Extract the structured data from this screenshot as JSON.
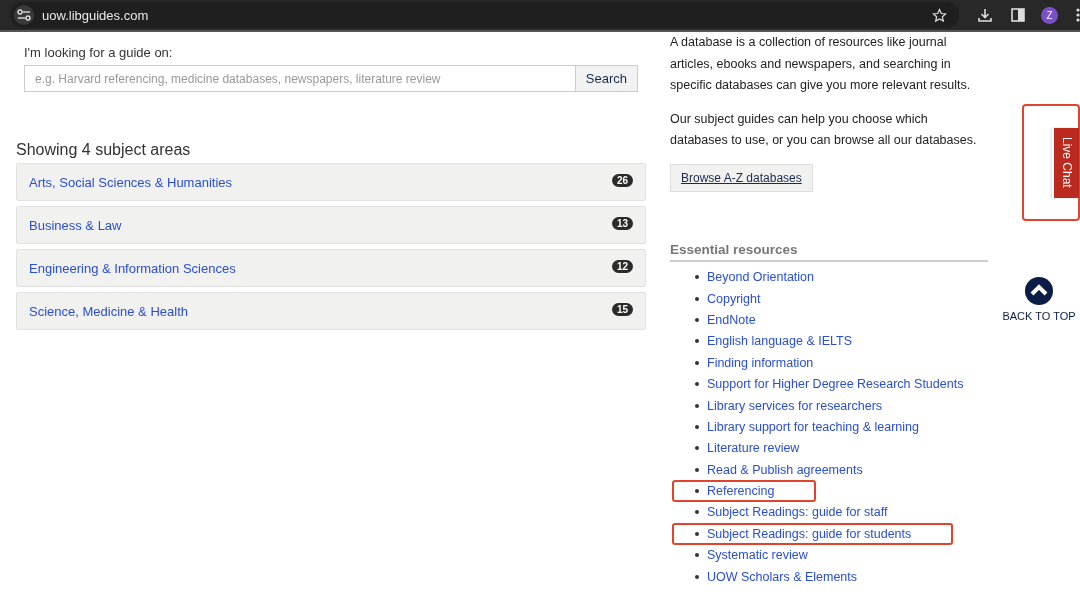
{
  "browser": {
    "url": "uow.libguides.com",
    "avatar": "Z"
  },
  "search": {
    "label": "I'm looking for a guide on:",
    "placeholder": "e.g. Harvard referencing, medicine databases, newspapers, literature review",
    "button": "Search"
  },
  "subjects": {
    "heading": "Showing 4 subject areas",
    "items": [
      {
        "name": "Arts, Social Sciences & Humanities",
        "count": "26"
      },
      {
        "name": "Business & Law",
        "count": "13"
      },
      {
        "name": "Engineering & Information Sciences",
        "count": "12"
      },
      {
        "name": "Science, Medicine & Health",
        "count": "15"
      }
    ]
  },
  "databases": {
    "paragraphs": [
      "A database is a collection of resources like journal articles, ebooks and newspapers, and searching in specific databases can give you more relevant results.",
      "Our subject guides can help you choose which databases to use, or you can browse all our databases."
    ],
    "button": "Browse A-Z databases"
  },
  "essential_resources": {
    "heading": "Essential resources",
    "items": [
      {
        "label": "Beyond Orientation",
        "highlighted": false
      },
      {
        "label": "Copyright",
        "highlighted": false
      },
      {
        "label": "EndNote",
        "highlighted": false
      },
      {
        "label": "English language & IELTS",
        "highlighted": false
      },
      {
        "label": "Finding information",
        "highlighted": false
      },
      {
        "label": "Support for Higher Degree Research Students",
        "highlighted": false
      },
      {
        "label": "Library services for researchers",
        "highlighted": false
      },
      {
        "label": "Library support for teaching & learning",
        "highlighted": false
      },
      {
        "label": "Literature review",
        "highlighted": false
      },
      {
        "label": "Read & Publish agreements",
        "highlighted": false
      },
      {
        "label": "Referencing",
        "highlighted": true
      },
      {
        "label": "Subject Readings: guide for staff",
        "highlighted": false
      },
      {
        "label": "Subject Readings: guide for students",
        "highlighted": true
      },
      {
        "label": "Systematic review",
        "highlighted": false
      },
      {
        "label": "UOW Scholars & Elements",
        "highlighted": false
      }
    ]
  },
  "live_chat": {
    "label": "Live Chat",
    "highlighted": true
  },
  "back_to_top": {
    "label": "BACK TO TOP"
  }
}
